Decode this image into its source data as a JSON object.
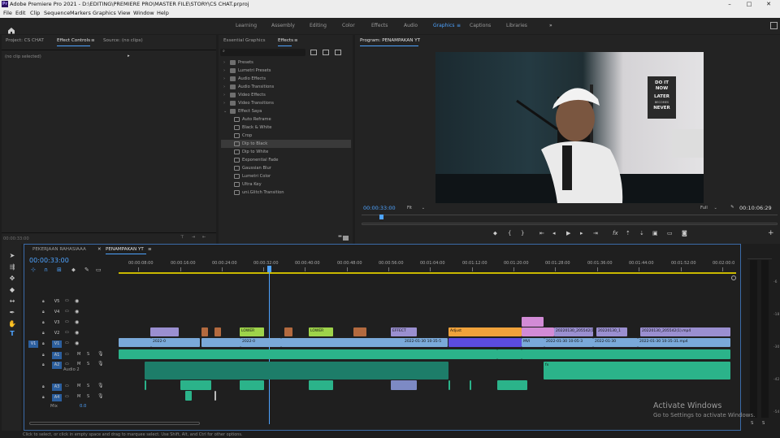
{
  "app": {
    "title": "Adobe Premiere Pro 2021 - D:\\EDITING\\PREMIERE PRO\\MASTER FILE\\STORY\\CS CHAT.prproj",
    "icon_text": "Pr"
  },
  "menu": [
    "File",
    "Edit",
    "Clip",
    "Sequence",
    "Markers",
    "Graphics",
    "View",
    "Window",
    "Help"
  ],
  "workspaces": [
    "Learning",
    "Assembly",
    "Editing",
    "Color",
    "Effects",
    "Audio",
    "Graphics",
    "Captions",
    "Libraries"
  ],
  "active_workspace": "Graphics",
  "left_panel": {
    "tabs": [
      "Project: CS CHAT",
      "Effect Controls",
      "Source: (no clips)"
    ],
    "active_tab": "Effect Controls",
    "no_clip": "(no clip selected)",
    "timecode": "00:00:33:00"
  },
  "effects_panel": {
    "tabs": [
      "Essential Graphics",
      "Effects"
    ],
    "active_tab": "Effects",
    "folders": [
      "Presets",
      "Lumetri Presets",
      "Audio Effects",
      "Audio Transitions",
      "Video Effects",
      "Video Transitions",
      "Effect Saya"
    ],
    "items": [
      "Auto Reframe",
      "Black & White",
      "Crop",
      "Dip to Black",
      "Dip to White",
      "Exponential Fade",
      "Gaussian Blur",
      "Lumetri Color",
      "Ultra Key",
      "uni.Glitch Transition"
    ],
    "selected": "Dip to Black"
  },
  "program": {
    "title": "Program: PENAMPAKAN YT",
    "timecode": "00:00:33:00",
    "fit": "Fit",
    "quality": "Full",
    "duration": "00:10:06:29",
    "poster": [
      "DO IT",
      "NOW",
      "LATER",
      "BECOMES",
      "NEVER"
    ]
  },
  "timeline": {
    "tabs": [
      "PEKERJAAN RAHASIAAA",
      "PENAMPAKAN YT"
    ],
    "active_tab": "PENAMPAKAN YT",
    "timecode": "00:00:33:00",
    "ruler": [
      "00:00:08:00",
      "00:00:16:00",
      "00:00:24:00",
      "00:00:32:00",
      "00:00:40:00",
      "00:00:48:00",
      "00:00:56:00",
      "00:01:04:00",
      "00:01:12:00",
      "00:01:20:00",
      "00:01:28:00",
      "00:01:36:00",
      "00:01:44:00",
      "00:01:52:00",
      "00:02:00:0"
    ],
    "video_tracks": [
      "V5",
      "V4",
      "V3",
      "V2",
      "V1"
    ],
    "audio_tracks": [
      "A1",
      "A2",
      "A3",
      "A4"
    ],
    "audio2_name": "Audio 2",
    "mix_label": "Mix",
    "mix_value": "0.0",
    "clip_labels": {
      "lower1": "LOWER",
      "lower2": "LOWER",
      "effect": "EFFECT",
      "adjust": "Adjust",
      "v2a": "20220130_205542(1)",
      "v2b": "20220130_1",
      "v2c": "20220130_205542(1).mp4",
      "v1a": "2022-0",
      "v1b": "2022-0",
      "v1c": "2022-01-30 10-35-5",
      "v1d": "MVI",
      "v1e": "2022-01-30 10-05-3",
      "v1f": "2022-01-30",
      "v1g": "2022-01-30 10-35-31.mp4",
      "a2fx": "fx"
    }
  },
  "meters": {
    "labels": [
      "S",
      "S"
    ]
  },
  "watermark": {
    "line1": "Activate Windows",
    "line2": "Go to Settings to activate Windows."
  },
  "statusbar": "Click to select, or click in empty space and drag to marquee select. Use Shift, Alt, and Ctrl for other options."
}
